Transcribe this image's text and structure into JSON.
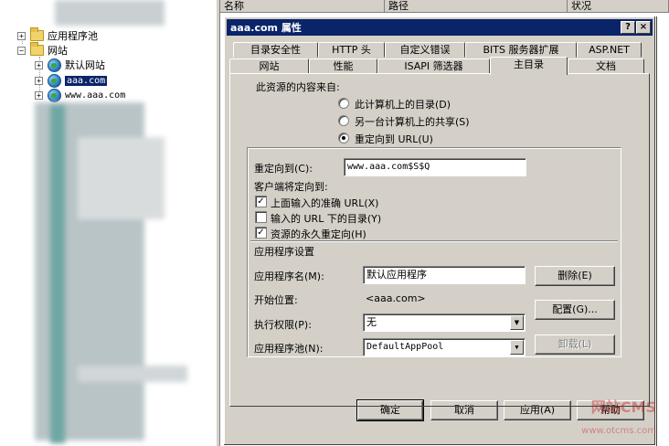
{
  "list_header": {
    "col_name": "名称",
    "col_path": "路径",
    "col_status": "状况"
  },
  "tree": {
    "app_pool": "应用程序池",
    "websites": "网站",
    "default_site": "默认网站",
    "site1": "aaa.com",
    "site2": "www.aaa.com"
  },
  "dialog": {
    "title": "aaa.com 属性",
    "help_btn": "?",
    "close_btn": "×",
    "tabs_row1": [
      "目录安全性",
      "HTTP 头",
      "自定义错误",
      "BITS 服务器扩展",
      "ASP.NET"
    ],
    "tabs_row2": [
      "网站",
      "性能",
      "ISAPI 筛选器",
      "主目录",
      "文档"
    ],
    "content_source_label": "此资源的内容来自:",
    "radio_local": "此计算机上的目录(D)",
    "radio_share": "另一台计算机上的共享(S)",
    "radio_url": "重定向到 URL(U)",
    "redirect_label": "重定向到(C):",
    "redirect_value": "www.aaa.com$S$Q",
    "client_redirect_label": "客户端将定向到:",
    "chk_exact": "上面输入的准确 URL(X)",
    "chk_below": "输入的 URL 下的目录(Y)",
    "chk_permanent": "资源的永久重定向(H)",
    "app_settings_label": "应用程序设置",
    "app_name_label": "应用程序名(M):",
    "app_name_value": "默认应用程序",
    "remove_btn": "删除(E)",
    "start_label": "开始位置:",
    "start_value": "<aaa.com>",
    "config_btn": "配置(G)...",
    "exec_label": "执行权限(P):",
    "exec_value": "无",
    "pool_label": "应用程序池(N):",
    "pool_value": "DefaultAppPool",
    "unload_btn": "卸载(L)",
    "ok_btn": "确定",
    "cancel_btn": "取消",
    "apply_btn": "应用(A)",
    "help_bottom_btn": "帮助"
  },
  "watermark": {
    "logo": "网站CMS",
    "url": "www.otcms.com"
  }
}
